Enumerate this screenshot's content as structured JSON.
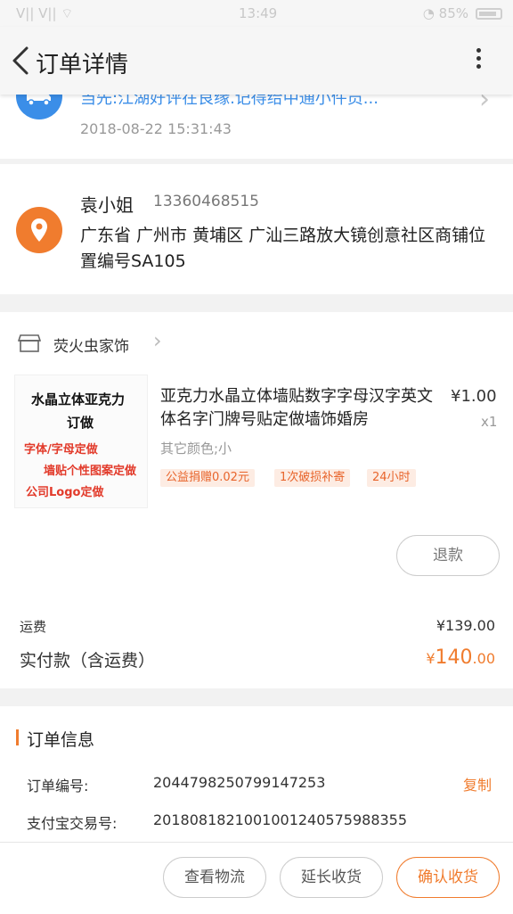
{
  "status_bar": {
    "signal": "ⴸ|| ⴸ|| ⌔",
    "time": "13:49",
    "battery": "◔ 85%"
  },
  "nav": {
    "title": "订单详情"
  },
  "logistics": {
    "text": "当先:江湖好评在良缘.记得给中通小件员...",
    "date": "2018-08-22 15:31:43"
  },
  "address": {
    "name": "袁小姐",
    "phone": "13360468515",
    "detail": "广东省 广州市 黄埔区    广汕三路放大镜创意社区商铺位置编号SA105"
  },
  "shop": {
    "name": "荧火虫家饰"
  },
  "product": {
    "image_text": {
      "line1": "水晶立体亚克力",
      "line2": "订做",
      "line3": "字体/字母定做",
      "line4": "墙贴个性图案定做",
      "line5": "公司Logo定做"
    },
    "title": "亚克力水晶立体墙贴数字字母汉字英文体名字门牌号贴定做墙饰婚房",
    "price": "¥1.00",
    "qty": "x1",
    "sku": "其它颜色;小",
    "tags": [
      "公益捐赠0.02元",
      "1次破损补寄",
      "24小时"
    ],
    "refund_label": "退款"
  },
  "totals": {
    "shipping_label": "运费",
    "shipping_value": "¥139.00",
    "paid_label": "实付款（含运费）",
    "paid_currency": "¥",
    "paid_int": "140",
    "paid_dec": ".00"
  },
  "order_info": {
    "title": "订单信息",
    "order_no_label": "订单编号:",
    "order_no": "2044798250799147253",
    "copy_label": "复制",
    "alipay_label": "支付宝交易号:",
    "alipay_no": "2018081821001001240575988355"
  },
  "actions": {
    "logistics": "查看物流",
    "extend": "延长收货",
    "confirm": "确认收货"
  },
  "colors": {
    "accent": "#f07c2e",
    "blue": "#3b8ee8"
  }
}
